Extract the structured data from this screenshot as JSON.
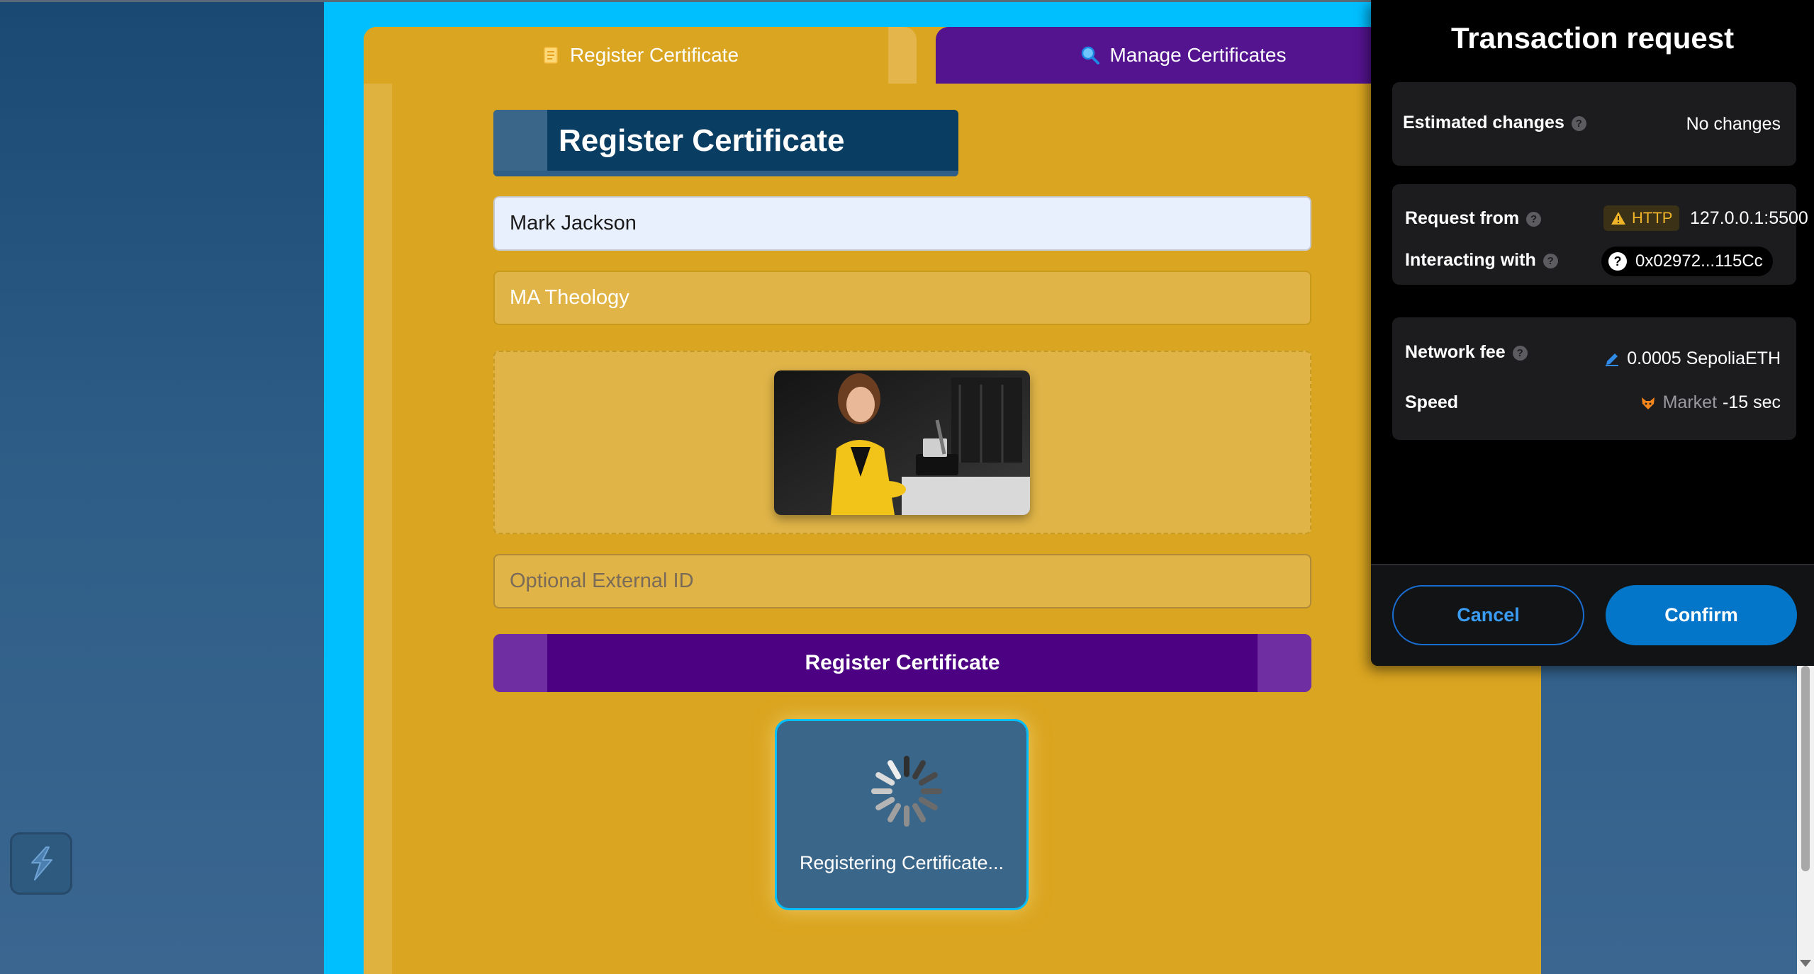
{
  "tabs": {
    "register_label": "Register Certificate",
    "register_icon": "page-icon",
    "manage_label": "Manage Certificates",
    "manage_icon": "magnifier-icon"
  },
  "form": {
    "heading": "Register Certificate",
    "name_value": "Mark Jackson",
    "degree_value": "MA Theology",
    "external_id_placeholder": "Optional External ID",
    "submit_label": "Register Certificate"
  },
  "loading": {
    "text": "Registering Certificate..."
  },
  "wallet": {
    "title": "Transaction request",
    "estimated_changes_label": "Estimated changes",
    "estimated_changes_value": "No changes",
    "request_from_label": "Request from",
    "request_protocol": "HTTP",
    "request_origin": "127.0.0.1:5500",
    "interacting_with_label": "Interacting with",
    "contract_address": "0x02972...115Cc",
    "network_fee_label": "Network fee",
    "network_fee_value": "0.0005 SepoliaETH",
    "speed_label": "Speed",
    "speed_mode": "Market",
    "speed_time": "-15 sec",
    "cancel_label": "Cancel",
    "confirm_label": "Confirm"
  },
  "colors": {
    "app_frame": "#00bfff",
    "panel": "#daa520",
    "manage_tab": "#54138f",
    "heading_bg": "#0a3d62",
    "submit_bg": "#4c0082",
    "wallet_bg": "#000000",
    "confirm_bg": "#0376c9",
    "warning": "#f0b429"
  }
}
